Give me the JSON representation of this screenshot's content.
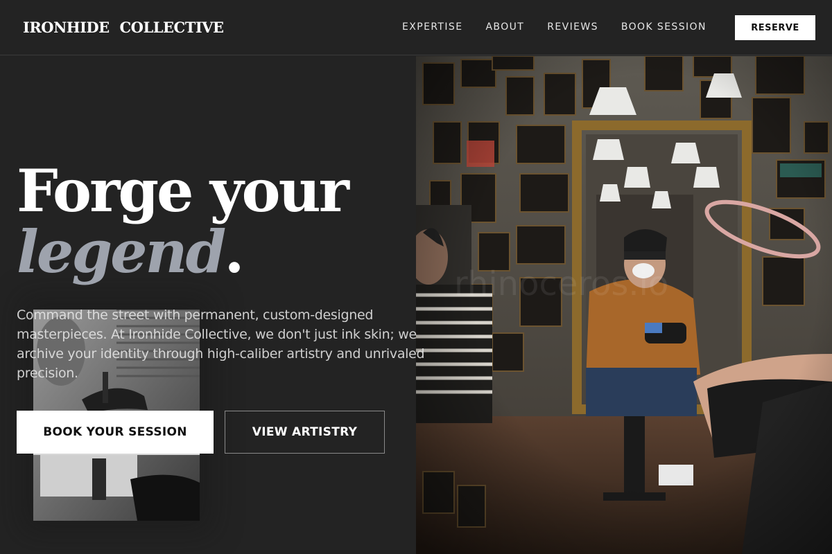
{
  "brand": {
    "name": "IRONHIDE  COLLECTIVE"
  },
  "nav": {
    "items": [
      {
        "label": "EXPERTISE"
      },
      {
        "label": "ABOUT"
      },
      {
        "label": "REVIEWS"
      },
      {
        "label": "BOOK SESSION"
      }
    ],
    "cta_label": "RESERVE"
  },
  "hero": {
    "headline_line1": "Forge your",
    "headline_emphasis": "legend",
    "headline_period": ".",
    "description": "Command the street with permanent, custom-designed masterpieces. At Ironhide Collective, we don't just ink skin; we archive your identity through high-caliber artistry and unrivaled precision.",
    "primary_button": "BOOK YOUR SESSION",
    "secondary_button": "VIEW ARTISTRY"
  },
  "colors": {
    "background": "#232323",
    "accent_muted": "#9ea3ad",
    "button_light": "#ffffff"
  }
}
